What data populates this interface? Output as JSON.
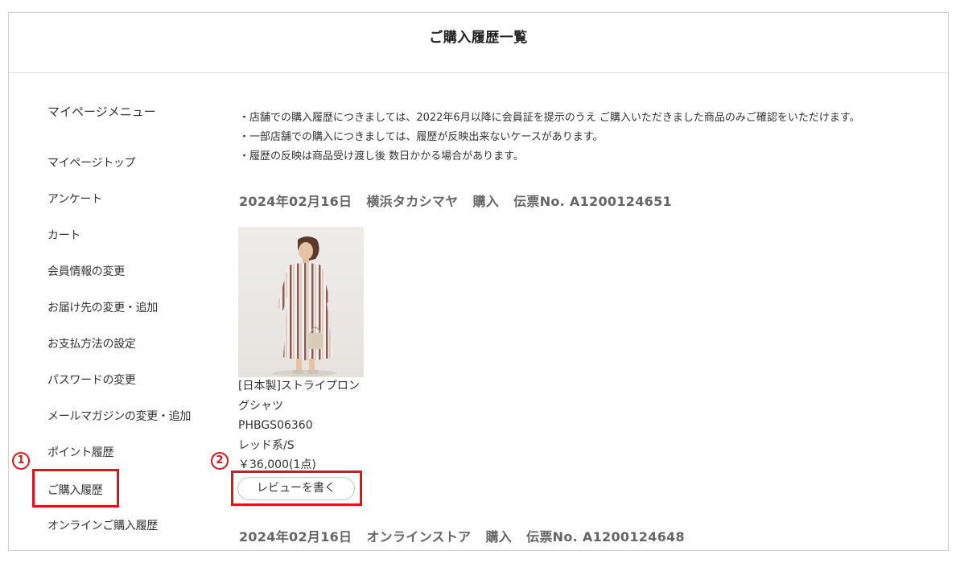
{
  "page": {
    "title": "ご購入履歴一覧"
  },
  "sidebar": {
    "heading": "マイページメニュー",
    "items": [
      {
        "label": "マイページトップ"
      },
      {
        "label": "アンケート"
      },
      {
        "label": "カート"
      },
      {
        "label": "会員情報の変更"
      },
      {
        "label": "お届け先の変更・追加"
      },
      {
        "label": "お支払方法の設定"
      },
      {
        "label": "パスワードの変更"
      },
      {
        "label": "メールマガジンの変更・追加"
      },
      {
        "label": "ポイント履歴"
      },
      {
        "label": "ご購入履歴"
      },
      {
        "label": "オンラインご購入履歴"
      }
    ]
  },
  "notes": [
    "・店舗での購入履歴につきましては、2022年6月以降に会員証を提示のうえ ご購入いただきました商品のみご確認をいただけます。",
    "・一部店舗での購入につきましては、履歴が反映出来ないケースがあります。",
    "・履歴の反映は商品受け渡し後 数日かかる場合があります。"
  ],
  "orders": [
    {
      "date": "2024年02月16日",
      "store": "横浜タカシマヤ",
      "type": "購入",
      "slip": "伝票No. A1200124651",
      "product": {
        "name_line1": "[日本製]ストライプロン",
        "name_line2": "グシャツ",
        "code": "PHBGS06360",
        "variant": "レッド系/S",
        "price": "￥36,000(1点)"
      },
      "review_label": "レビューを書く"
    },
    {
      "date": "2024年02月16日",
      "store": "オンラインストア",
      "type": "購入",
      "slip": "伝票No. A1200124648"
    }
  ],
  "annotations": {
    "marker1": "1",
    "marker2": "2",
    "color": "#e0141e"
  }
}
